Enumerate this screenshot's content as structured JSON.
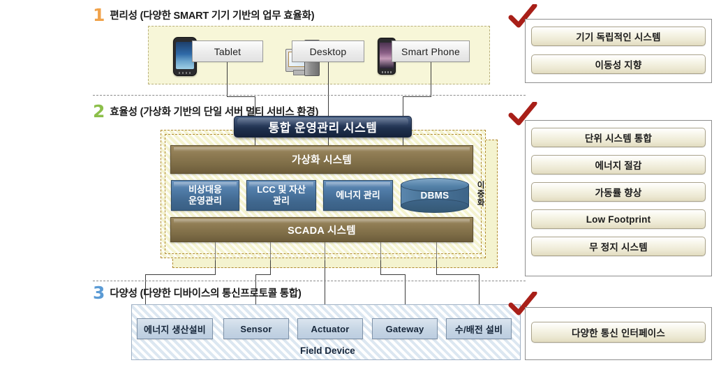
{
  "sections": [
    {
      "number": "1",
      "title": "편리성 (다양한 SMART 기기 기반의 업무 효율화)",
      "color": "#f0a24a"
    },
    {
      "number": "2",
      "title": "효율성 (가상화 기반의 단일 서버  멀티 서비스 환경)",
      "color": "#8cbf4a"
    },
    {
      "number": "3",
      "title": "다양성 (다양한 디바이스의 통신프로토콜 통합)",
      "color": "#5b9bd5"
    }
  ],
  "layer_devices": {
    "items": [
      {
        "label": "Tablet",
        "icon": "tablet-device-icon"
      },
      {
        "label": "Desktop",
        "icon": "desktop-computer-icon"
      },
      {
        "label": "Smart Phone",
        "icon": "smartphone-device-icon"
      }
    ]
  },
  "layer_platform": {
    "title_bar": "통합 운영관리 시스템",
    "virtualization": "가상화 시스템",
    "modules": [
      "비상대응\n운영관리",
      "LCC 및 자산\n관리",
      "에너지 관리"
    ],
    "module_lines": [
      [
        "비상대응",
        "운영관리"
      ],
      [
        "LCC 및 자산",
        "관리"
      ],
      [
        "에너지 관리",
        ""
      ]
    ],
    "database": "DBMS",
    "scada": "SCADA 시스템",
    "redundancy_label": "이중화"
  },
  "layer_field": {
    "items": [
      "에너지 생산설비",
      "Sensor",
      "Actuator",
      "Gateway",
      "수/배전 설비"
    ],
    "caption": "Field Device"
  },
  "panels": [
    {
      "check": "check-mark-icon",
      "items": [
        "기기 독립적인 시스템",
        "이동성 지향"
      ]
    },
    {
      "check": "check-mark-icon",
      "items": [
        "단위 시스템 통합",
        "에너지 절감",
        "가동률 향상",
        "Low Footprint",
        "무 정지 시스템"
      ]
    },
    {
      "check": "check-mark-icon",
      "items": [
        "다양한 통신 인터페이스"
      ]
    }
  ],
  "colors": {
    "accent_orange": "#f0a24a",
    "accent_green": "#8cbf4a",
    "accent_blue": "#5b9bd5",
    "check_red": "#a81f18",
    "navy": "#1e2f4d",
    "brown": "#8d7a52",
    "cream": "#f7f6d8"
  }
}
